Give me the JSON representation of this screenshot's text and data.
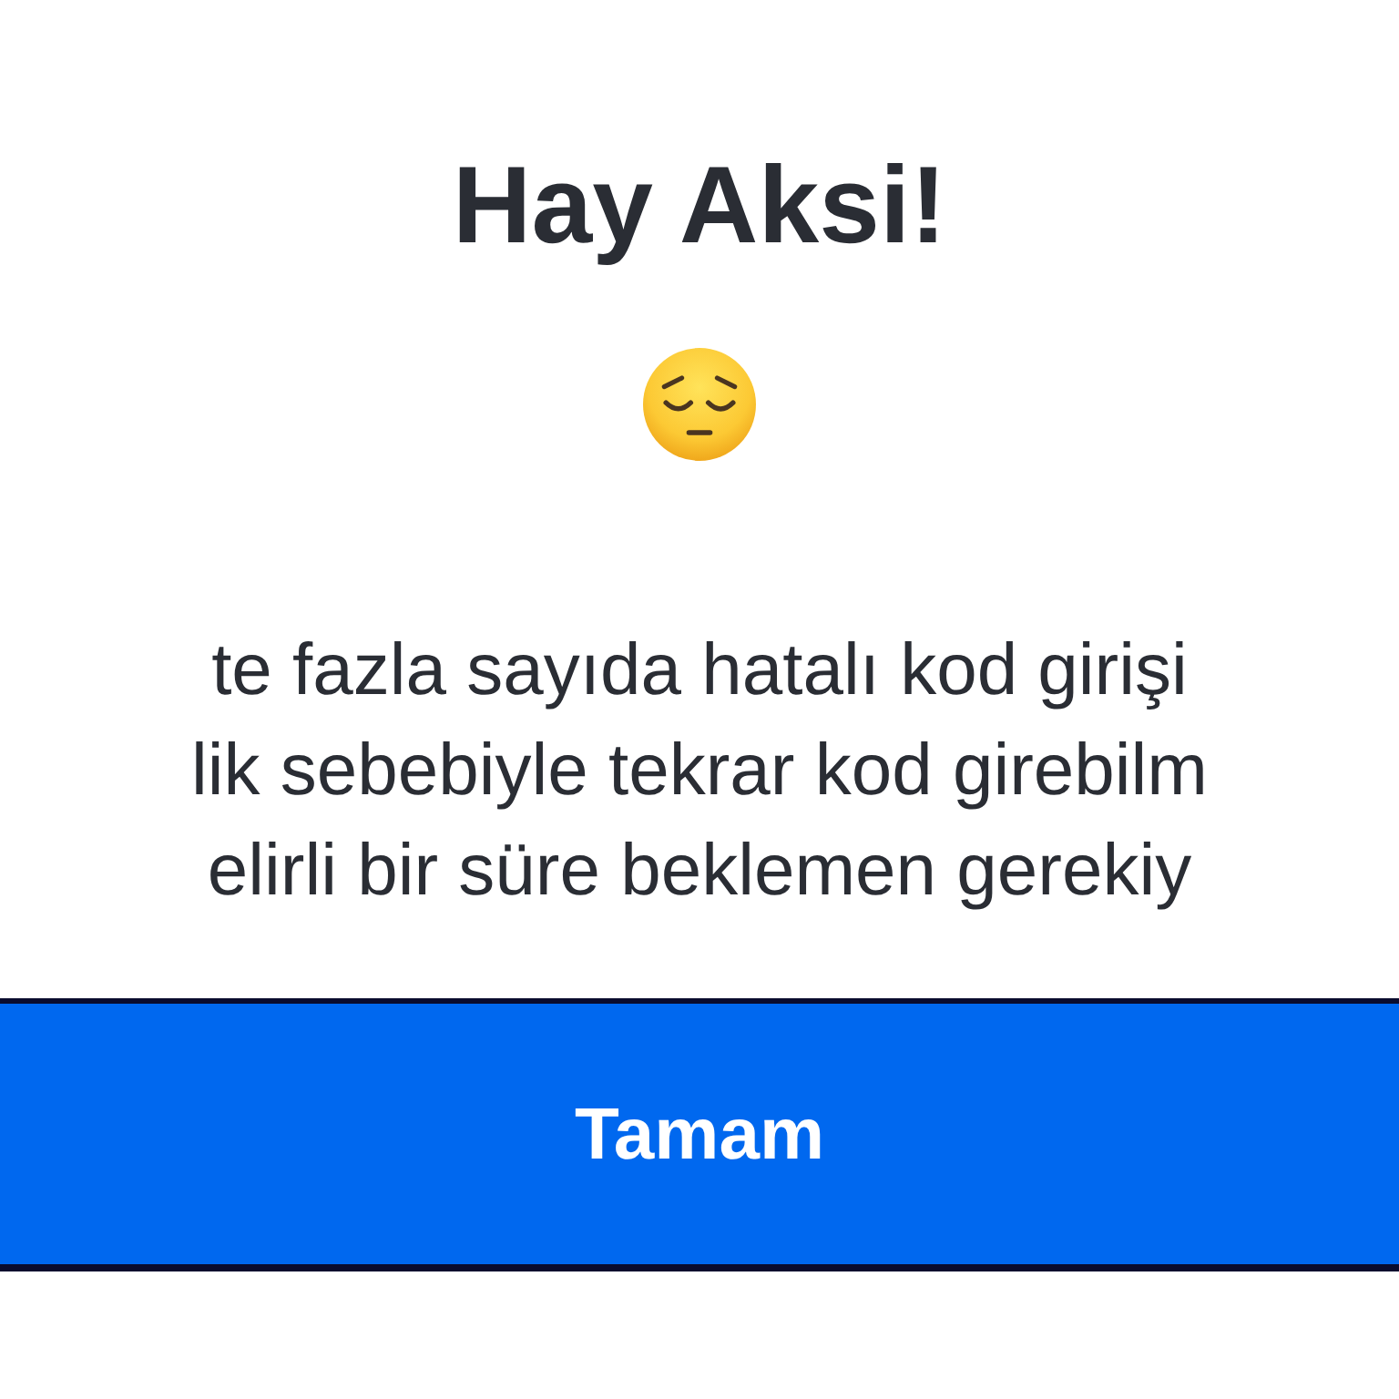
{
  "dialog": {
    "title": "Hay Aksi!",
    "message_lines": [
      "te fazla sayıda hatalı kod girişi",
      "lik sebebiyle tekrar kod girebilm",
      "elirli bir süre beklemen gerekiy"
    ],
    "button": "Tamam"
  }
}
